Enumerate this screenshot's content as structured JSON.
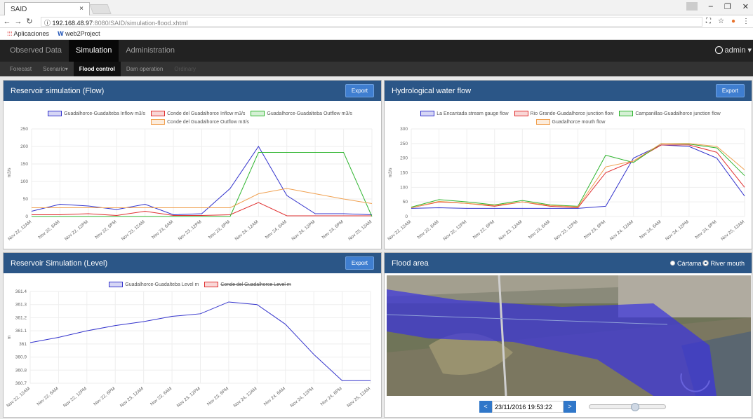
{
  "browser": {
    "tab_title": "SAID",
    "tab_close": "×",
    "url_host": "192.168.48.97",
    "url_path": ":8080/SAID/simulation-flood.xhtml",
    "bookmarks": [
      "Aplicaciones",
      "web2Project"
    ]
  },
  "nav": {
    "items": [
      "Observed Data",
      "Simulation",
      "Administration"
    ],
    "active": "Simulation",
    "user": "admin"
  },
  "subnav": {
    "items": [
      "Forecast",
      "Scenario",
      "Flood control",
      "Dam operation",
      "Ordinary"
    ],
    "active": "Flood control"
  },
  "panels": {
    "flow": {
      "title": "Reservoir simulation (Flow)",
      "button": "Export"
    },
    "hydro": {
      "title": "Hydrological water flow",
      "button": "Export"
    },
    "level": {
      "title": "Reservoir Simulation (Level)",
      "button": "Export"
    },
    "flood": {
      "title": "Flood area",
      "options": [
        "Cártama",
        "River mouth"
      ],
      "selected": "River mouth"
    }
  },
  "flood_controls": {
    "prev": "<",
    "next": ">",
    "datetime": "23/11/2016 19:53:22",
    "slider_position": 0.6
  },
  "chart_data": [
    {
      "type": "line",
      "title": "Reservoir simulation (Flow)",
      "ylabel": "m3/s",
      "ylim": [
        0,
        250
      ],
      "yticks": [
        0,
        50,
        100,
        150,
        200,
        250
      ],
      "x": [
        "Nov 22, 12AM",
        "Nov 22, 6AM",
        "Nov 22, 12PM",
        "Nov 22, 6PM",
        "Nov 23, 12AM",
        "Nov 23, 6AM",
        "Nov 23, 12PM",
        "Nov 23, 6PM",
        "Nov 24, 12AM",
        "Nov 24, 6AM",
        "Nov 24, 12PM",
        "Nov 24, 6PM",
        "Nov 25, 12AM"
      ],
      "series": [
        {
          "name": "Guadalhorce-Guadalteba Inflow m3/s",
          "color": "#3333cc",
          "values": [
            15,
            35,
            30,
            20,
            35,
            5,
            8,
            80,
            200,
            60,
            8,
            8,
            5
          ]
        },
        {
          "name": "Conde del Guadalhorce Inflow m3/s",
          "color": "#e03030",
          "values": [
            5,
            5,
            8,
            3,
            15,
            3,
            3,
            5,
            40,
            2,
            2,
            2,
            2
          ]
        },
        {
          "name": "Guadalhorce-Guadalteba Outflow m3/s",
          "color": "#2fb52f",
          "values": [
            0,
            0,
            0,
            0,
            0,
            0,
            0,
            0,
            183,
            183,
            183,
            183,
            0
          ]
        },
        {
          "name": "Conde del Guadalhorce Outflow m3/s",
          "color": "#f0a050",
          "values": [
            25,
            25,
            25,
            25,
            25,
            25,
            25,
            25,
            65,
            80,
            65,
            50,
            37
          ]
        }
      ]
    },
    {
      "type": "line",
      "title": "Hydrological water flow",
      "ylabel": "m3/s",
      "ylim": [
        0,
        300
      ],
      "yticks": [
        0,
        50,
        100,
        150,
        200,
        250,
        300
      ],
      "x": [
        "Nov 22, 12AM",
        "Nov 22, 6AM",
        "Nov 22, 12PM",
        "Nov 22, 6PM",
        "Nov 23, 12AM",
        "Nov 23, 6AM",
        "Nov 23, 12PM",
        "Nov 23, 6PM",
        "Nov 24, 12AM",
        "Nov 24, 6AM",
        "Nov 24, 12PM",
        "Nov 24, 6PM",
        "Nov 25, 12AM"
      ],
      "series": [
        {
          "name": "La Encantada stream gauge flow",
          "color": "#3333cc",
          "values": [
            28,
            30,
            28,
            28,
            28,
            28,
            28,
            35,
            200,
            245,
            240,
            200,
            70
          ]
        },
        {
          "name": "Rio Grande-Guadalhorce junction flow",
          "color": "#e03030",
          "values": [
            30,
            50,
            45,
            35,
            50,
            35,
            30,
            150,
            190,
            245,
            245,
            220,
            100
          ]
        },
        {
          "name": "Campanillas-Guadalhorce junction flow",
          "color": "#2fb52f",
          "values": [
            32,
            58,
            50,
            40,
            55,
            40,
            35,
            210,
            185,
            250,
            248,
            235,
            140
          ]
        },
        {
          "name": "Guadalhorce mouth flow",
          "color": "#f0a050",
          "values": [
            30,
            52,
            45,
            38,
            50,
            38,
            33,
            170,
            190,
            250,
            250,
            240,
            160
          ]
        }
      ]
    },
    {
      "type": "line",
      "title": "Reservoir Simulation (Level)",
      "ylabel": "m",
      "ylim": [
        360.7,
        361.4
      ],
      "yticks": [
        360.7,
        360.8,
        360.9,
        361,
        361.1,
        361.2,
        361.3,
        361.4
      ],
      "x": [
        "Nov 22, 12AM",
        "Nov 22, 6AM",
        "Nov 22, 12PM",
        "Nov 22, 6PM",
        "Nov 23, 12AM",
        "Nov 23, 6AM",
        "Nov 23, 12PM",
        "Nov 23, 6PM",
        "Nov 24, 12AM",
        "Nov 24, 6AM",
        "Nov 24, 12PM",
        "Nov 24, 6PM",
        "Nov 25, 12AM"
      ],
      "series": [
        {
          "name": "Guadalhorce-Guadalteba Level m",
          "color": "#3333cc",
          "values": [
            361.01,
            361.05,
            361.1,
            361.14,
            361.17,
            361.21,
            361.23,
            361.32,
            361.3,
            361.15,
            360.92,
            360.72,
            360.72
          ]
        },
        {
          "name": "Conde del Guadalhorce Level m",
          "color": "#e03030",
          "hidden": true,
          "values": []
        }
      ]
    }
  ]
}
